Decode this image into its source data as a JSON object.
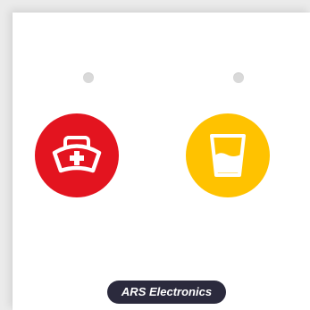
{
  "brand": {
    "label": "ARS Electronics",
    "color": "#2b2a3d"
  },
  "buttons": [
    {
      "icon": "nurse-cap-icon",
      "color": "#e3141f"
    },
    {
      "icon": "water-glass-icon",
      "color": "#ffc200"
    }
  ],
  "indicators": [
    {
      "color": "#d9d9d9"
    },
    {
      "color": "#d9d9d9"
    }
  ]
}
